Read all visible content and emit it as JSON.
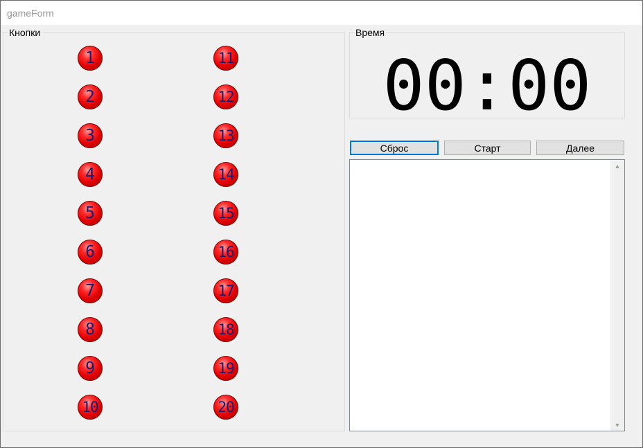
{
  "window": {
    "title": "gameForm"
  },
  "buttons_group": {
    "label": "Кнопки",
    "left_column": [
      "1",
      "2",
      "3",
      "4",
      "5",
      "6",
      "7",
      "8",
      "9",
      "10"
    ],
    "right_column": [
      "11",
      "12",
      "13",
      "14",
      "15",
      "16",
      "17",
      "18",
      "19",
      "20"
    ]
  },
  "time_group": {
    "label": "Время",
    "value": "00:00"
  },
  "actions": {
    "reset": "Сброс",
    "start": "Старт",
    "next": "Далее"
  },
  "colors": {
    "button_red": "#e00000",
    "button_text": "#1a1a6e",
    "focus_border": "#0078d7"
  },
  "icons": {
    "scroll_up": "▲",
    "scroll_down": "▼"
  }
}
